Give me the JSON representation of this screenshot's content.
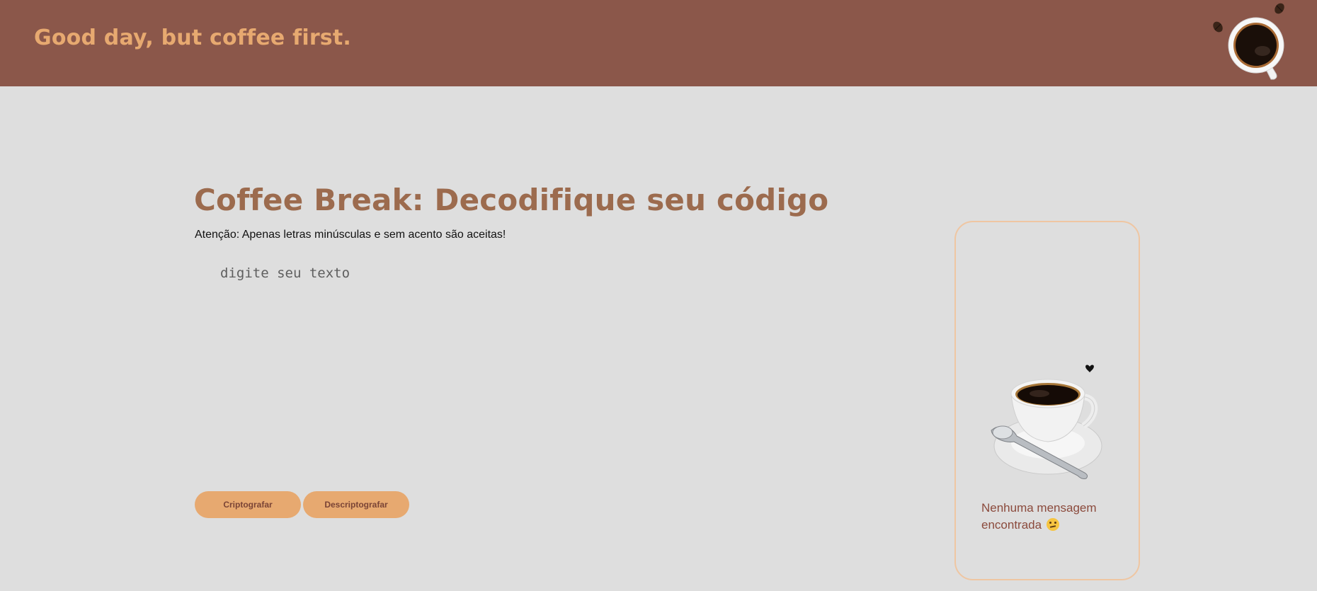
{
  "header": {
    "title": "Good day, but coffee first.",
    "logo_icon": "coffee-cup-top-view-icon"
  },
  "main": {
    "title": "Coffee Break: Decodifique seu código",
    "warning": "Atenção: Apenas letras minúsculas e sem acento são aceitas!",
    "input": {
      "placeholder": "digite seu texto",
      "value": ""
    },
    "buttons": {
      "encrypt_label": "Criptografar",
      "decrypt_label": "Descriptografar"
    }
  },
  "result": {
    "illustration_icon": "coffee-cup-with-saucer-icon",
    "empty_message": "Nenhuma mensagem encontrada",
    "empty_emoji": "confused-face-icon"
  },
  "colors": {
    "header_bg": "#8b574a",
    "accent": "#e7a970",
    "title": "#9c6b4e",
    "background": "#dedede",
    "panel_border": "#efc6a2",
    "message_text": "#8b4a3c"
  }
}
